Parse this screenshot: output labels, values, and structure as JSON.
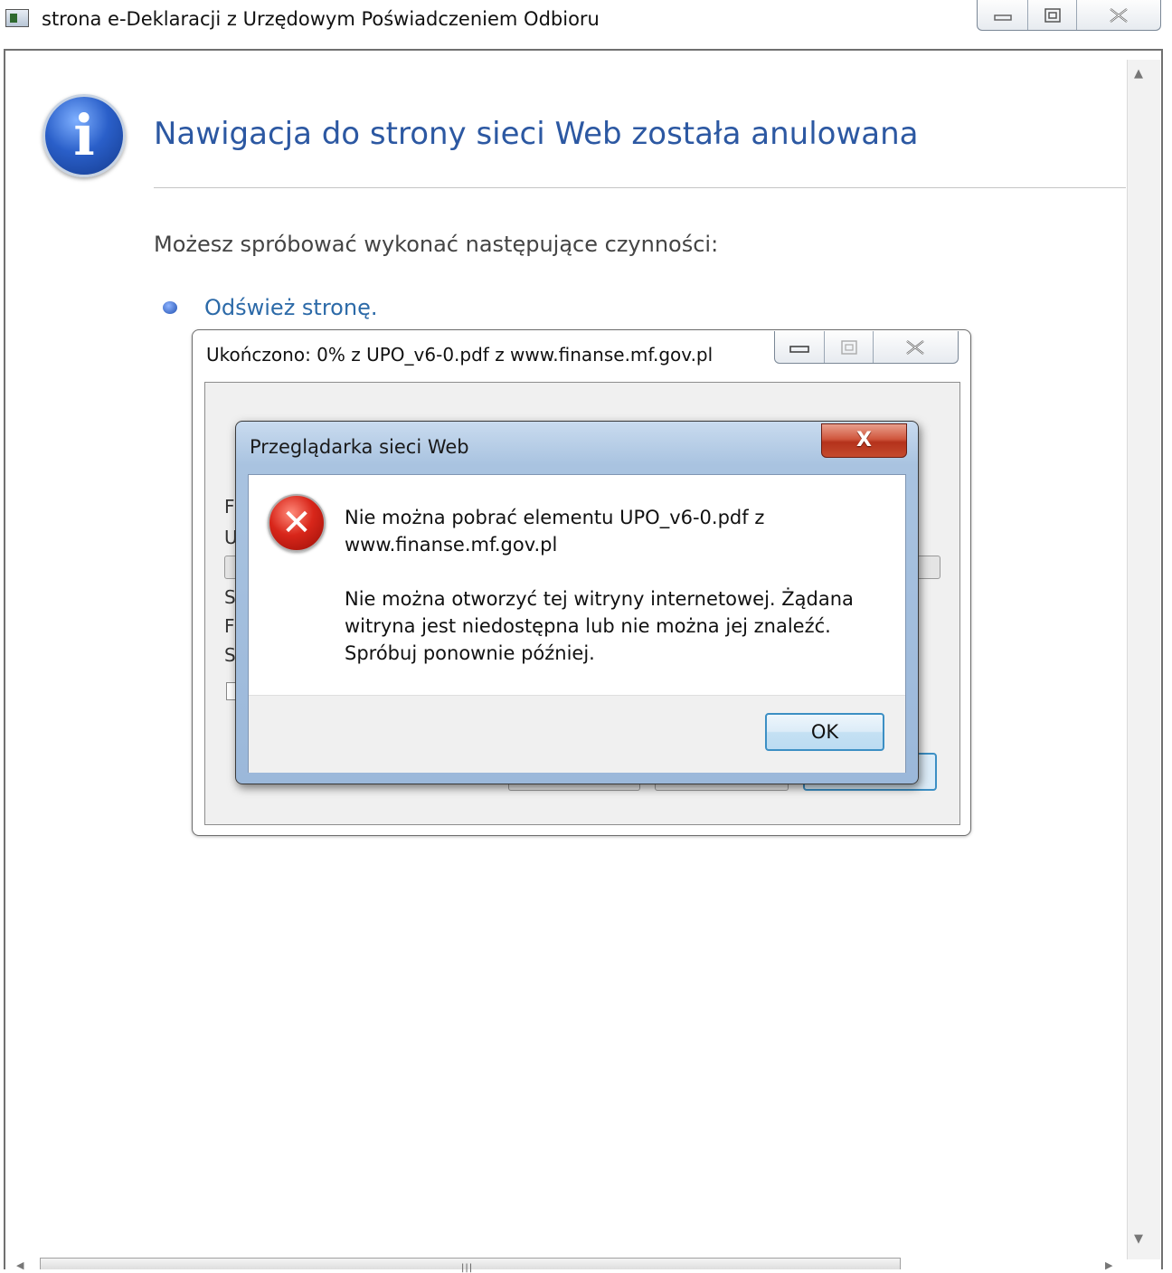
{
  "main_window": {
    "title": "strona e-Deklaracji z Urzędowym Poświadczeniem Odbioru",
    "icons": {
      "app": "browser-page-icon",
      "minimize": "minimize-icon",
      "maximize": "restore-icon",
      "close": "close-icon"
    }
  },
  "page": {
    "info_icon": "i",
    "heading": "Nawigacja do strony sieci Web została anulowana",
    "suggest_text": "Możesz spróbować wykonać następujące czynności:",
    "refresh_link": "Odśwież stronę."
  },
  "download_dialog": {
    "title": "Ukończono: 0% z UPO_v6-0.pdf z www.finanse.mf.gov.pl",
    "partial_labels": [
      "F",
      "U",
      "S",
      "F",
      "S"
    ]
  },
  "error_dialog": {
    "title": "Przeglądarka sieci Web",
    "close_glyph": "X",
    "icon_glyph": "✕",
    "message_line1": "Nie można pobrać elementu UPO_v6-0.pdf z",
    "message_line2": "www.finanse.mf.gov.pl",
    "detail_line1": "Nie można otworzyć tej witryny internetowej. Żądana",
    "detail_line2": "witryna jest niedostępna lub nie można jej znaleźć.",
    "detail_line3": "Spróbuj ponownie później.",
    "ok_label": "OK"
  },
  "colors": {
    "heading": "#2c58a2",
    "link": "#2c6aa8",
    "error_icon": "#d8261a",
    "close_button": "#c44a2e",
    "ok_border": "#3c8fc4"
  }
}
